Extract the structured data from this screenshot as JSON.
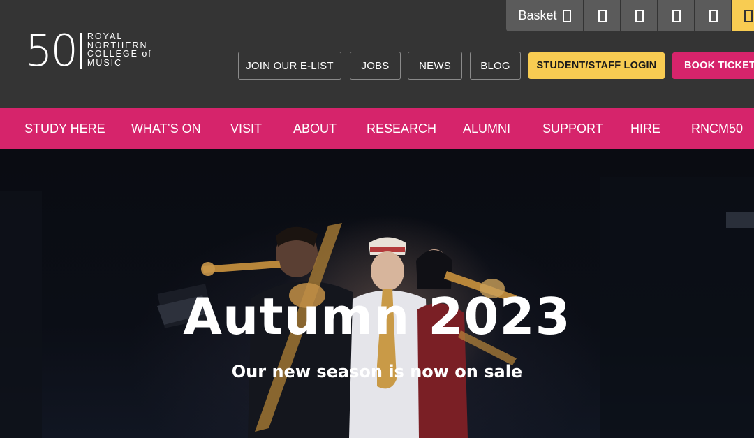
{
  "header": {
    "logo": {
      "number": "50",
      "lines": [
        "ROYAL",
        "NORTHERN",
        "COLLEGE of",
        "MUSIC"
      ]
    },
    "utility": {
      "basket_label": "Basket",
      "icons": [
        "basket-icon",
        "utility-icon-1",
        "utility-icon-2",
        "utility-icon-3",
        "utility-icon-4",
        "utility-icon-5"
      ]
    },
    "buttons": {
      "elist": "JOIN OUR E-LIST",
      "jobs": "JOBS",
      "news": "NEWS",
      "blog": "BLOG",
      "login": "STUDENT/STAFF LOGIN",
      "tickets": "BOOK TICKETS"
    }
  },
  "nav": {
    "items": [
      {
        "label": "STUDY HERE"
      },
      {
        "label": "WHAT’S ON"
      },
      {
        "label": "VISIT"
      },
      {
        "label": "ABOUT"
      },
      {
        "label": "RESEARCH"
      },
      {
        "label": "ALUMNI"
      },
      {
        "label": "SUPPORT"
      },
      {
        "label": "HIRE"
      },
      {
        "label": "RNCM50"
      }
    ]
  },
  "hero": {
    "title": "Autumn 2023",
    "subtitle": "Our new season is now on sale"
  },
  "colors": {
    "header_bg": "#343434",
    "brand_pink": "#d6246b",
    "accent_yellow": "#f8cc52",
    "utility_grey": "#5b5b5b"
  }
}
